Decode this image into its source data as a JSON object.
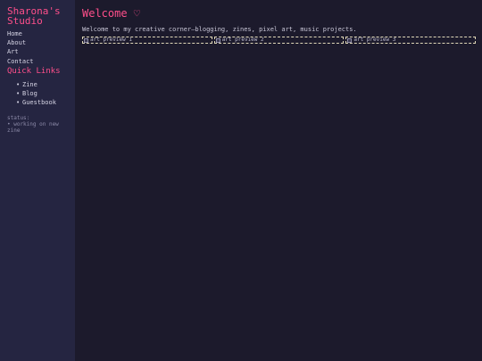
{
  "sidebar": {
    "title": "Sharona's Studio",
    "nav": [
      "Home",
      "About",
      "Art",
      "Contact"
    ],
    "quick_links_title": "Quick Links",
    "quick_links": [
      "Zine",
      "Blog",
      "Guestbook"
    ],
    "bullet": "•",
    "status_label": "status:",
    "status_text": "• working on new zine"
  },
  "main": {
    "title": "Welcome ♡",
    "intro": "Welcome to my creative corner—blogging, zines, pixel art, music projects.",
    "art_previews": [
      "art preview 1",
      "art preview 2",
      "art preview 3"
    ]
  },
  "colors": {
    "background": "#1c1a2c",
    "sidebar": "#252541",
    "accent": "#ff4f8b"
  }
}
